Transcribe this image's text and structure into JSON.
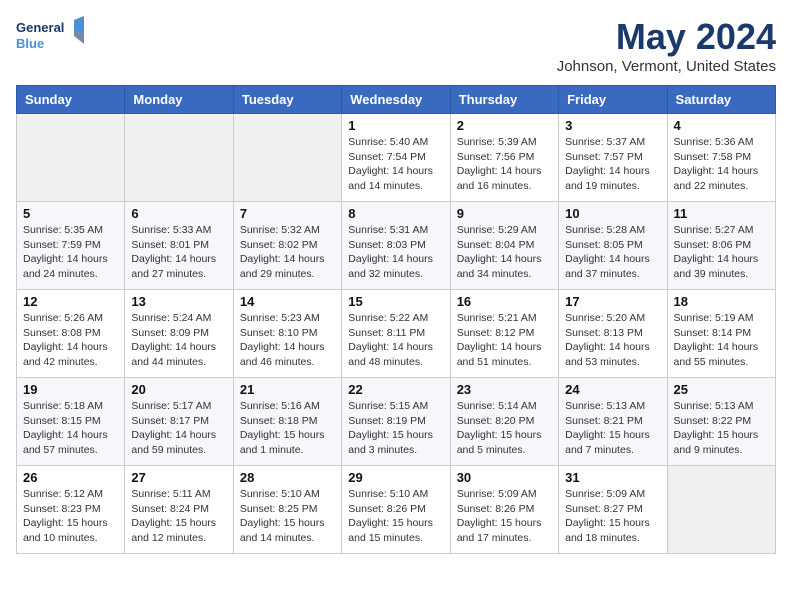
{
  "header": {
    "logo_line1": "General",
    "logo_line2": "Blue",
    "title": "May 2024",
    "location": "Johnson, Vermont, United States"
  },
  "days_of_week": [
    "Sunday",
    "Monday",
    "Tuesday",
    "Wednesday",
    "Thursday",
    "Friday",
    "Saturday"
  ],
  "weeks": [
    [
      {
        "day": "",
        "sunrise": "",
        "sunset": "",
        "daylight": "",
        "empty": true
      },
      {
        "day": "",
        "sunrise": "",
        "sunset": "",
        "daylight": "",
        "empty": true
      },
      {
        "day": "",
        "sunrise": "",
        "sunset": "",
        "daylight": "",
        "empty": true
      },
      {
        "day": "1",
        "sunrise": "Sunrise: 5:40 AM",
        "sunset": "Sunset: 7:54 PM",
        "daylight": "Daylight: 14 hours and 14 minutes."
      },
      {
        "day": "2",
        "sunrise": "Sunrise: 5:39 AM",
        "sunset": "Sunset: 7:56 PM",
        "daylight": "Daylight: 14 hours and 16 minutes."
      },
      {
        "day": "3",
        "sunrise": "Sunrise: 5:37 AM",
        "sunset": "Sunset: 7:57 PM",
        "daylight": "Daylight: 14 hours and 19 minutes."
      },
      {
        "day": "4",
        "sunrise": "Sunrise: 5:36 AM",
        "sunset": "Sunset: 7:58 PM",
        "daylight": "Daylight: 14 hours and 22 minutes."
      }
    ],
    [
      {
        "day": "5",
        "sunrise": "Sunrise: 5:35 AM",
        "sunset": "Sunset: 7:59 PM",
        "daylight": "Daylight: 14 hours and 24 minutes."
      },
      {
        "day": "6",
        "sunrise": "Sunrise: 5:33 AM",
        "sunset": "Sunset: 8:01 PM",
        "daylight": "Daylight: 14 hours and 27 minutes."
      },
      {
        "day": "7",
        "sunrise": "Sunrise: 5:32 AM",
        "sunset": "Sunset: 8:02 PM",
        "daylight": "Daylight: 14 hours and 29 minutes."
      },
      {
        "day": "8",
        "sunrise": "Sunrise: 5:31 AM",
        "sunset": "Sunset: 8:03 PM",
        "daylight": "Daylight: 14 hours and 32 minutes."
      },
      {
        "day": "9",
        "sunrise": "Sunrise: 5:29 AM",
        "sunset": "Sunset: 8:04 PM",
        "daylight": "Daylight: 14 hours and 34 minutes."
      },
      {
        "day": "10",
        "sunrise": "Sunrise: 5:28 AM",
        "sunset": "Sunset: 8:05 PM",
        "daylight": "Daylight: 14 hours and 37 minutes."
      },
      {
        "day": "11",
        "sunrise": "Sunrise: 5:27 AM",
        "sunset": "Sunset: 8:06 PM",
        "daylight": "Daylight: 14 hours and 39 minutes."
      }
    ],
    [
      {
        "day": "12",
        "sunrise": "Sunrise: 5:26 AM",
        "sunset": "Sunset: 8:08 PM",
        "daylight": "Daylight: 14 hours and 42 minutes."
      },
      {
        "day": "13",
        "sunrise": "Sunrise: 5:24 AM",
        "sunset": "Sunset: 8:09 PM",
        "daylight": "Daylight: 14 hours and 44 minutes."
      },
      {
        "day": "14",
        "sunrise": "Sunrise: 5:23 AM",
        "sunset": "Sunset: 8:10 PM",
        "daylight": "Daylight: 14 hours and 46 minutes."
      },
      {
        "day": "15",
        "sunrise": "Sunrise: 5:22 AM",
        "sunset": "Sunset: 8:11 PM",
        "daylight": "Daylight: 14 hours and 48 minutes."
      },
      {
        "day": "16",
        "sunrise": "Sunrise: 5:21 AM",
        "sunset": "Sunset: 8:12 PM",
        "daylight": "Daylight: 14 hours and 51 minutes."
      },
      {
        "day": "17",
        "sunrise": "Sunrise: 5:20 AM",
        "sunset": "Sunset: 8:13 PM",
        "daylight": "Daylight: 14 hours and 53 minutes."
      },
      {
        "day": "18",
        "sunrise": "Sunrise: 5:19 AM",
        "sunset": "Sunset: 8:14 PM",
        "daylight": "Daylight: 14 hours and 55 minutes."
      }
    ],
    [
      {
        "day": "19",
        "sunrise": "Sunrise: 5:18 AM",
        "sunset": "Sunset: 8:15 PM",
        "daylight": "Daylight: 14 hours and 57 minutes."
      },
      {
        "day": "20",
        "sunrise": "Sunrise: 5:17 AM",
        "sunset": "Sunset: 8:17 PM",
        "daylight": "Daylight: 14 hours and 59 minutes."
      },
      {
        "day": "21",
        "sunrise": "Sunrise: 5:16 AM",
        "sunset": "Sunset: 8:18 PM",
        "daylight": "Daylight: 15 hours and 1 minute."
      },
      {
        "day": "22",
        "sunrise": "Sunrise: 5:15 AM",
        "sunset": "Sunset: 8:19 PM",
        "daylight": "Daylight: 15 hours and 3 minutes."
      },
      {
        "day": "23",
        "sunrise": "Sunrise: 5:14 AM",
        "sunset": "Sunset: 8:20 PM",
        "daylight": "Daylight: 15 hours and 5 minutes."
      },
      {
        "day": "24",
        "sunrise": "Sunrise: 5:13 AM",
        "sunset": "Sunset: 8:21 PM",
        "daylight": "Daylight: 15 hours and 7 minutes."
      },
      {
        "day": "25",
        "sunrise": "Sunrise: 5:13 AM",
        "sunset": "Sunset: 8:22 PM",
        "daylight": "Daylight: 15 hours and 9 minutes."
      }
    ],
    [
      {
        "day": "26",
        "sunrise": "Sunrise: 5:12 AM",
        "sunset": "Sunset: 8:23 PM",
        "daylight": "Daylight: 15 hours and 10 minutes."
      },
      {
        "day": "27",
        "sunrise": "Sunrise: 5:11 AM",
        "sunset": "Sunset: 8:24 PM",
        "daylight": "Daylight: 15 hours and 12 minutes."
      },
      {
        "day": "28",
        "sunrise": "Sunrise: 5:10 AM",
        "sunset": "Sunset: 8:25 PM",
        "daylight": "Daylight: 15 hours and 14 minutes."
      },
      {
        "day": "29",
        "sunrise": "Sunrise: 5:10 AM",
        "sunset": "Sunset: 8:26 PM",
        "daylight": "Daylight: 15 hours and 15 minutes."
      },
      {
        "day": "30",
        "sunrise": "Sunrise: 5:09 AM",
        "sunset": "Sunset: 8:26 PM",
        "daylight": "Daylight: 15 hours and 17 minutes."
      },
      {
        "day": "31",
        "sunrise": "Sunrise: 5:09 AM",
        "sunset": "Sunset: 8:27 PM",
        "daylight": "Daylight: 15 hours and 18 minutes."
      },
      {
        "day": "",
        "sunrise": "",
        "sunset": "",
        "daylight": "",
        "empty": true
      }
    ]
  ]
}
